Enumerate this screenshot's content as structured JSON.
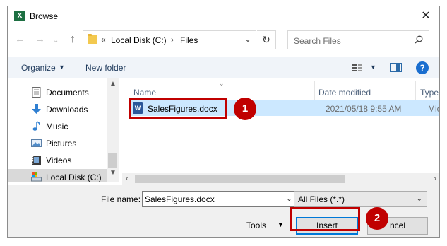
{
  "window": {
    "title": "Browse",
    "app_icon_letter": "X"
  },
  "nav": {
    "breadcrumb_prefix": "«",
    "breadcrumb": [
      "Local Disk (C:)",
      "Files"
    ],
    "search_placeholder": "Search Files"
  },
  "toolbar": {
    "organize": "Organize",
    "new_folder": "New folder",
    "help": "?"
  },
  "sidebar": {
    "items": [
      {
        "label": "Documents",
        "icon": "documents-icon"
      },
      {
        "label": "Downloads",
        "icon": "downloads-icon"
      },
      {
        "label": "Music",
        "icon": "music-icon"
      },
      {
        "label": "Pictures",
        "icon": "pictures-icon"
      },
      {
        "label": "Videos",
        "icon": "videos-icon"
      },
      {
        "label": "Local Disk (C:)",
        "icon": "drive-icon",
        "selected": true
      }
    ]
  },
  "file_list": {
    "columns": [
      "Name",
      "Date modified",
      "Type"
    ],
    "rows": [
      {
        "name": "SalesFigures.docx",
        "date": "2021/05/18 9:55 AM",
        "type": "Micro"
      }
    ]
  },
  "bottom": {
    "file_name_label": "File name:",
    "file_name_value": "SalesFigures.docx",
    "filter": "All Files (*.*)",
    "tools": "Tools",
    "insert": "Insert",
    "cancel": "ncel"
  },
  "annotations": {
    "badge1": "1",
    "badge2": "2"
  },
  "colors": {
    "accent": "#0078d7",
    "annotation_red": "#c00000",
    "selection": "#cce8ff"
  }
}
